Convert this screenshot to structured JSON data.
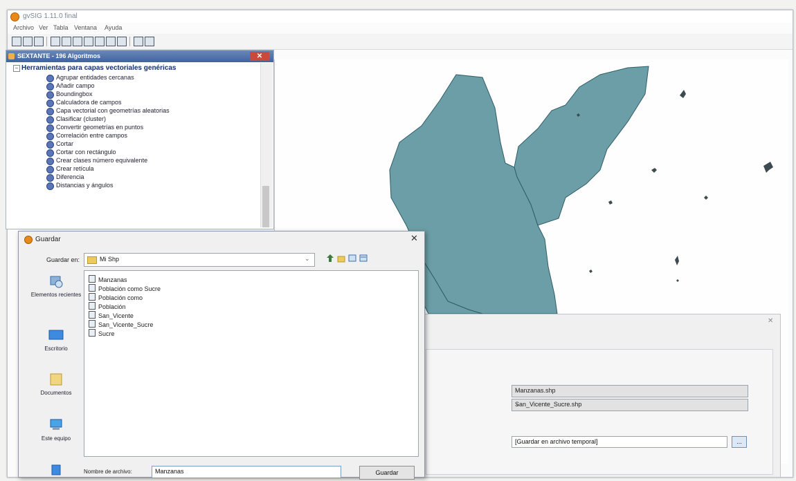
{
  "window": {
    "title": "gvSIG 1.11.0 final"
  },
  "menubar": [
    "Archivo",
    "Ver",
    "Tabla",
    "Ventana",
    "Ayuda"
  ],
  "tree_panel": {
    "title": "SEXTANTE - 196 Algoritmos",
    "group": "Herramientas para capas vectoriales genéricas",
    "items": [
      "Agrupar entidades cercanas",
      "Añadir campo",
      "Boundingbox",
      "Calculadora de campos",
      "Capa vectorial con geometrías aleatorias",
      "Clasificar (cluster)",
      "Convertir geometrías en puntos",
      "Correlación entre campos",
      "Cortar",
      "Cortar con rectángulo",
      "Crear clases número equivalente",
      "Crear retícula",
      "Diferencia",
      "Distancias y ángulos"
    ]
  },
  "save_dialog": {
    "title": "Guardar",
    "look_in_label": "Guardar en:",
    "look_in_value": "Mi Shp",
    "places": [
      "Elementos recientes",
      "Escritorio",
      "Documentos",
      "Este equipo",
      ""
    ],
    "files": [
      "Manzanas",
      "Población como Sucre",
      "Población como",
      "Población",
      "San_Vicente",
      "San_Vicente_Sucre",
      "Sucre"
    ],
    "file_name_label": "Nombre de archivo:",
    "file_name_value": "Manzanas",
    "save_button": "Guardar"
  },
  "right_dialog": {
    "close": "✕",
    "select1": "Manzanas.shp",
    "select2": "San_Vicente_Sucre.shp",
    "output": "[Guardar en archivo temporal]",
    "browse": "..."
  },
  "colors": {
    "map_fill": "#6b9ea6",
    "map_stroke": "#2f5d66",
    "title_bar": "#3f63a2"
  }
}
